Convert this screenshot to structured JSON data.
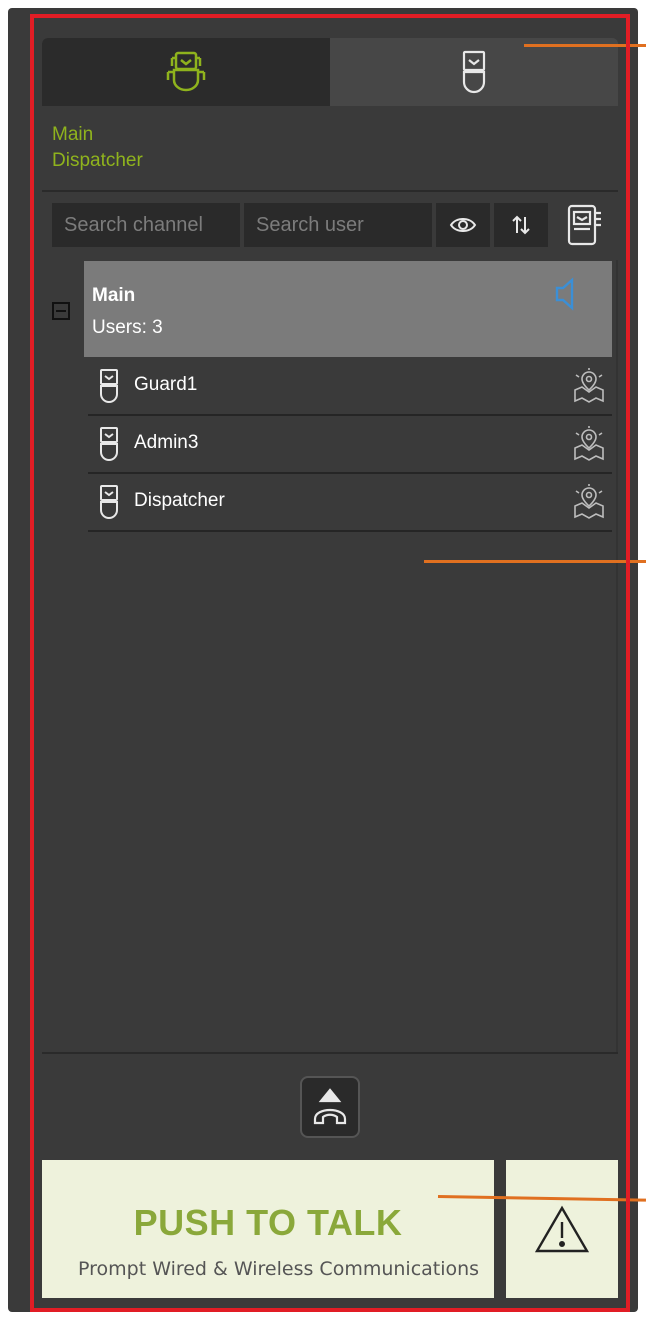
{
  "tabs": [
    {
      "name": "channels",
      "icon": "group-radio-icon",
      "active": true
    },
    {
      "name": "users",
      "icon": "radio-device-icon",
      "active": false
    }
  ],
  "selection": {
    "line1": "Main",
    "line2": "Dispatcher"
  },
  "search": {
    "channel_placeholder": "Search channel",
    "user_placeholder": "Search user",
    "buttons": [
      "eye-icon",
      "sort-icon",
      "device-settings-icon"
    ]
  },
  "channel": {
    "name": "Main",
    "users_text": "Users: 3",
    "status_icon": "speaker-icon"
  },
  "users": [
    {
      "name": "Guard1"
    },
    {
      "name": "Admin3"
    },
    {
      "name": "Dispatcher"
    }
  ],
  "ptt": {
    "label": "PUSH TO TALK"
  },
  "caption": "Prompt Wired & Wireless Communications",
  "colors": {
    "accent_green": "#8fb31d",
    "ptt_text": "#8aa83a",
    "ptt_bg": "#eef2dc",
    "frame_red": "#e11d25",
    "callout_orange": "#e07020",
    "speaker_blue": "#3b8fd6"
  }
}
